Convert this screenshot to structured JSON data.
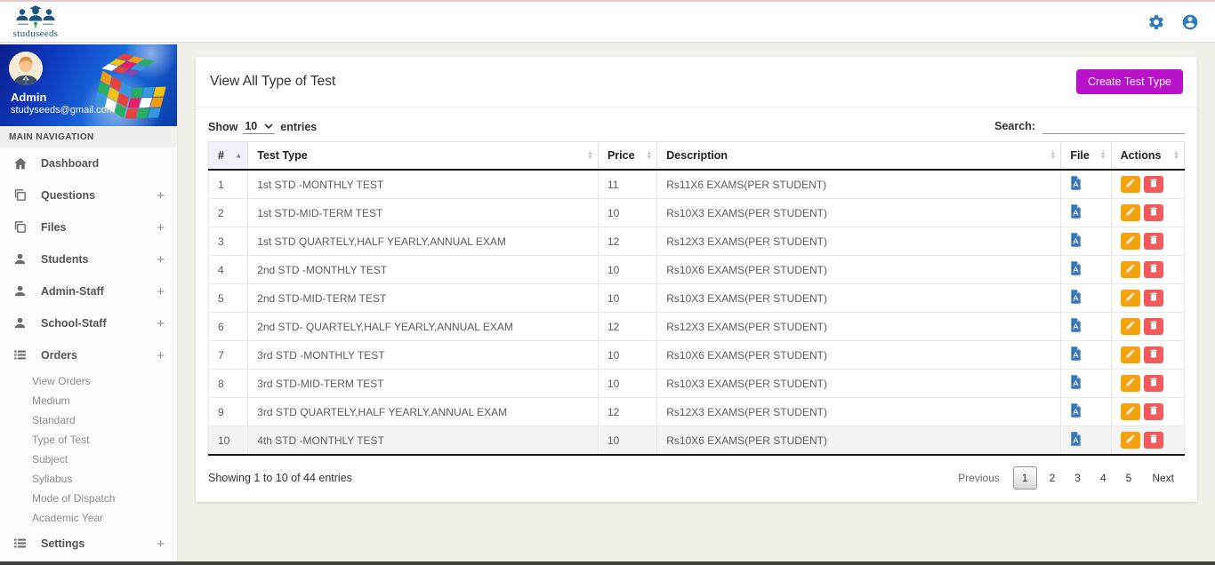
{
  "navbar": {
    "logo_text": "studuseeds",
    "icons": [
      "people-logo-icon",
      "gear-icon",
      "user-circle-icon"
    ]
  },
  "profile": {
    "name": "Admin",
    "email": "studyseeds@gmail.com"
  },
  "sidebar": {
    "section_header": "MAIN NAVIGATION",
    "items": [
      {
        "label": "Dashboard",
        "icon": "home",
        "expandable": false
      },
      {
        "label": "Questions",
        "icon": "copy",
        "expandable": true
      },
      {
        "label": "Files",
        "icon": "copy",
        "expandable": true
      },
      {
        "label": "Students",
        "icon": "person",
        "expandable": true
      },
      {
        "label": "Admin-Staff",
        "icon": "person",
        "expandable": true
      },
      {
        "label": "School-Staff",
        "icon": "person",
        "expandable": true
      },
      {
        "label": "Orders",
        "icon": "list",
        "expandable": true,
        "children": [
          "View Orders",
          "Medium",
          "Standard",
          "Type of Test",
          "Subject",
          "Syllabus",
          "Mode of Dispatch",
          "Academic Year"
        ]
      },
      {
        "label": "Settings",
        "icon": "list",
        "expandable": true
      }
    ]
  },
  "main": {
    "title": "View All Type of Test",
    "create_button_label": "Create Test Type",
    "show_label": "Show",
    "show_value": "10",
    "entries_label": "entries",
    "search_label": "Search:",
    "search_value": "",
    "table": {
      "headers": [
        "#",
        "Test Type",
        "Price",
        "Description",
        "File",
        "Actions"
      ],
      "sorted_column": 0,
      "rows": [
        {
          "num": "1",
          "test_type": "1st STD -MONTHLY TEST",
          "price": "11",
          "description": "Rs11X6 EXAMS(PER STUDENT)"
        },
        {
          "num": "2",
          "test_type": "1st STD-MID-TERM TEST",
          "price": "10",
          "description": "Rs10X3 EXAMS(PER STUDENT)"
        },
        {
          "num": "3",
          "test_type": "1st STD QUARTELY,HALF YEARLY,ANNUAL EXAM",
          "price": "12",
          "description": "Rs12X3 EXAMS(PER STUDENT)"
        },
        {
          "num": "4",
          "test_type": "2nd STD -MONTHLY TEST",
          "price": "10",
          "description": "Rs10X6 EXAMS(PER STUDENT)"
        },
        {
          "num": "5",
          "test_type": "2nd STD-MID-TERM TEST",
          "price": "10",
          "description": "Rs10X3 EXAMS(PER STUDENT)"
        },
        {
          "num": "6",
          "test_type": "2nd STD- QUARTELY,HALF YEARLY,ANNUAL EXAM",
          "price": "12",
          "description": "Rs12X3 EXAMS(PER STUDENT)"
        },
        {
          "num": "7",
          "test_type": "3rd STD -MONTHLY TEST",
          "price": "10",
          "description": "Rs10X6 EXAMS(PER STUDENT)"
        },
        {
          "num": "8",
          "test_type": "3rd STD-MID-TERM TEST",
          "price": "10",
          "description": "Rs10X3 EXAMS(PER STUDENT)"
        },
        {
          "num": "9",
          "test_type": "3rd STD QUARTELY,HALF YEARLY,ANNUAL EXAM",
          "price": "12",
          "description": "Rs12X3 EXAMS(PER STUDENT)"
        },
        {
          "num": "10",
          "test_type": "4th STD -MONTHLY TEST",
          "price": "10",
          "description": "Rs10X6 EXAMS(PER STUDENT)"
        }
      ],
      "file_icon": "pdf-file-icon",
      "action_icons": [
        "edit-pencil-icon",
        "delete-trash-icon"
      ]
    },
    "footer": {
      "showing_text": "Showing 1 to 10 of 44 entries",
      "pagination": {
        "prev": "Previous",
        "pages": [
          "1",
          "2",
          "3",
          "4",
          "5"
        ],
        "next": "Next",
        "current": "1"
      }
    }
  },
  "colors": {
    "create_button": "#b811c9",
    "edit_button": "#f6a20e",
    "delete_button": "#f15b5b",
    "pdf_icon": "#3878b8",
    "navbar_icons": "#2e7cb9",
    "sorted_header_bg": "#f0f1fa"
  }
}
